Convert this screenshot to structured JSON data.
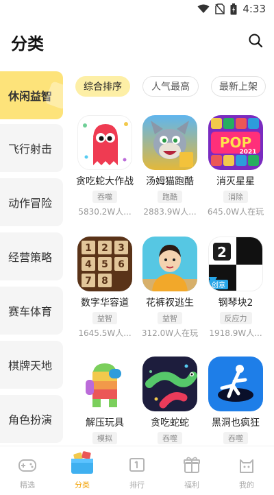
{
  "status_bar": {
    "time": "4:33"
  },
  "header": {
    "title": "分类"
  },
  "sidebar": {
    "items": [
      {
        "label": "休闲益智",
        "active": true
      },
      {
        "label": "飞行射击"
      },
      {
        "label": "动作冒险"
      },
      {
        "label": "经营策略"
      },
      {
        "label": "赛车体育"
      },
      {
        "label": "棋牌天地"
      },
      {
        "label": "角色扮演"
      }
    ]
  },
  "sort_tabs": [
    {
      "label": "综合排序",
      "active": true
    },
    {
      "label": "人气最高"
    },
    {
      "label": "最新上架"
    }
  ],
  "games": [
    {
      "name": "贪吃蛇大作战",
      "tag": "吞噬",
      "players": "5830.2W人..."
    },
    {
      "name": "汤姆猫跑酷",
      "tag": "跑酷",
      "players": "2883.9W人..."
    },
    {
      "name": "消灭星星",
      "tag": "消除",
      "players": "645.0W人在玩"
    },
    {
      "name": "数字华容道",
      "tag": "益智",
      "players": "1645.5W人..."
    },
    {
      "name": "花裤衩逃生",
      "tag": "益智",
      "players": "312.0W人在玩"
    },
    {
      "name": "钢琴块2",
      "tag": "反应力",
      "players": "1918.9W人..."
    },
    {
      "name": "解压玩具",
      "tag": "模拟",
      "players": ""
    },
    {
      "name": "贪吃蛇蛇",
      "tag": "吞噬",
      "players": ""
    },
    {
      "name": "黑洞也疯狂",
      "tag": "吞噬",
      "players": ""
    }
  ],
  "icon_text": {
    "pop_logo": "POP",
    "pop_year": "2021",
    "puzzle_tiles": [
      "1",
      "2",
      "3",
      "4",
      "5",
      "6",
      "7",
      "8"
    ],
    "piano_number": "2",
    "piano_badge": "创意"
  },
  "bottom_nav": [
    {
      "label": "精选",
      "icon": "gamepad-icon"
    },
    {
      "label": "分类",
      "icon": "category-box-icon",
      "active": true
    },
    {
      "label": "排行",
      "icon": "ranking-icon"
    },
    {
      "label": "福利",
      "icon": "gift-icon"
    },
    {
      "label": "我的",
      "icon": "profile-cat-icon"
    }
  ],
  "colors": {
    "accent": "#fde37a",
    "active_tab": "#fdefa6",
    "nav_active": "#f2a100"
  }
}
